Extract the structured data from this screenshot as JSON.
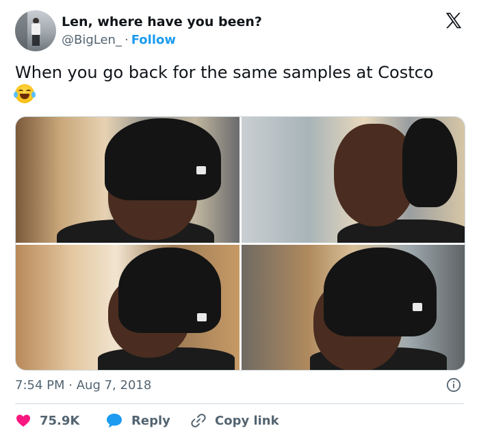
{
  "author": {
    "name": "Len, where have you been?",
    "handle": "@BigLen_",
    "separator": "·",
    "follow_label": "Follow"
  },
  "platform": {
    "logo_icon": "x-logo-icon"
  },
  "tweet": {
    "text": "When you go back for the same samples at Costco",
    "emoji": "face-with-tears-of-joy-emoji",
    "media": [
      {
        "icon": "photo"
      },
      {
        "icon": "photo"
      },
      {
        "icon": "photo"
      },
      {
        "icon": "photo"
      }
    ],
    "time": "7:54 PM",
    "dot": "·",
    "date": "Aug 7, 2018"
  },
  "actions": {
    "likes": "75.9K",
    "reply_label": "Reply",
    "copy_link_label": "Copy link"
  },
  "colors": {
    "accent": "#1d9bf0",
    "like": "#f91880",
    "text": "#0f1419",
    "muted": "#536471",
    "border": "#cfd9de"
  }
}
